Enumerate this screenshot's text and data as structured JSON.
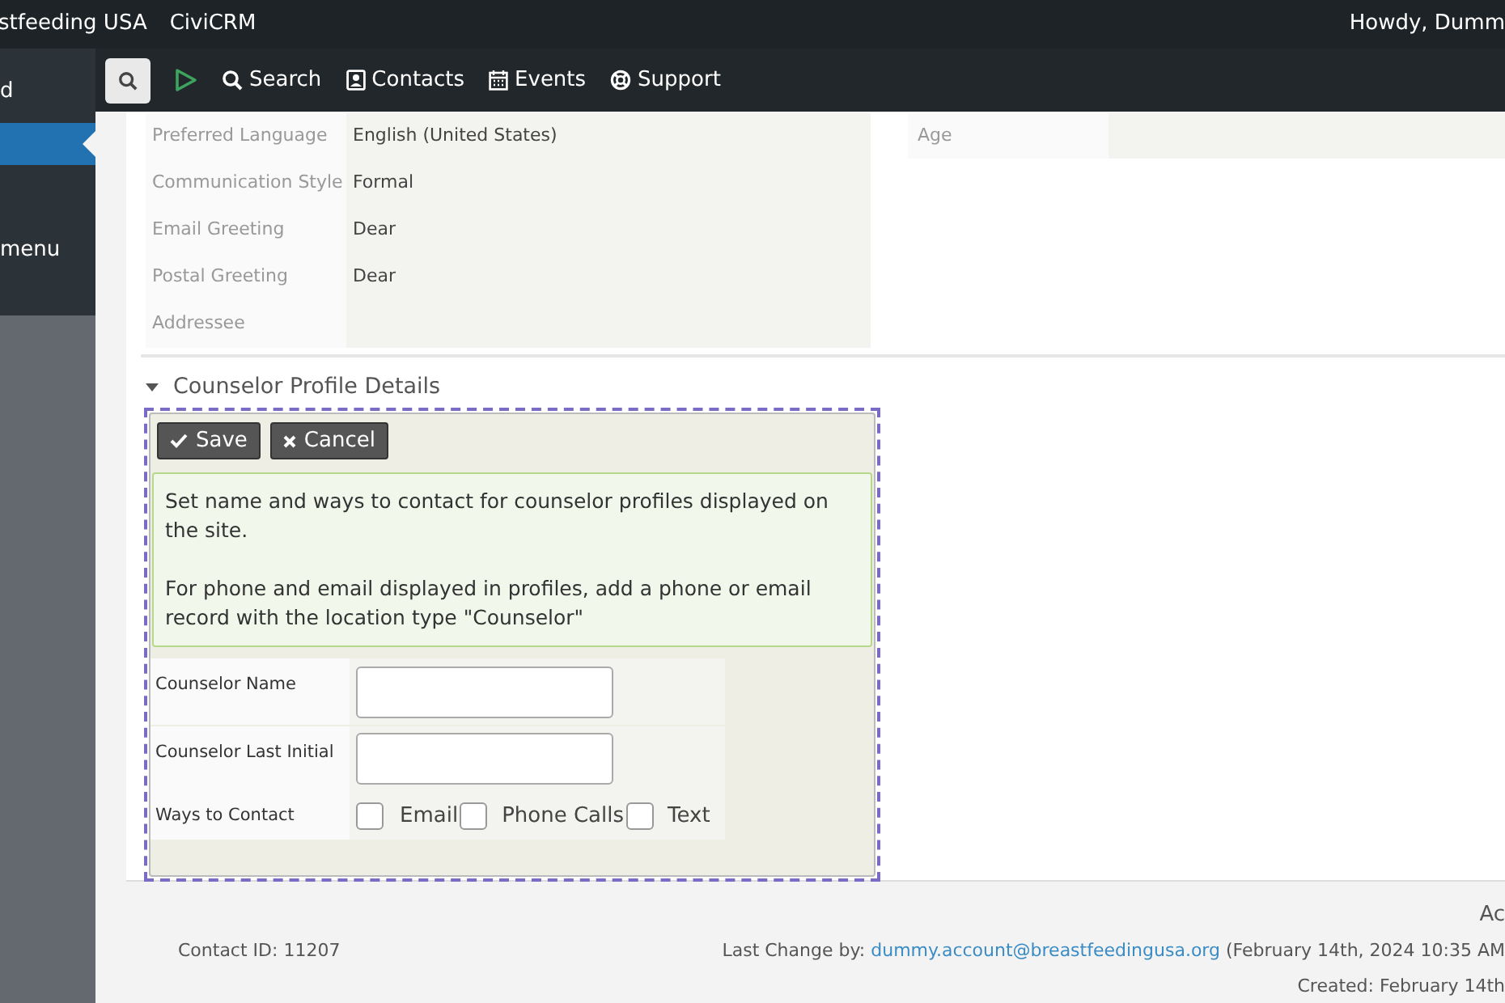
{
  "admin_bar": {
    "site_name": "stfeeding USA",
    "app_name": "CiviCRM",
    "greeting": "Howdy, Dumm"
  },
  "sidebar": {
    "items": [
      {
        "label": "d",
        "selected": false
      },
      {
        "selected": true
      },
      {
        "label": "menu",
        "selected": false
      }
    ]
  },
  "civi_nav": {
    "items": [
      {
        "label": "Search"
      },
      {
        "label": "Contacts"
      },
      {
        "label": "Events"
      },
      {
        "label": "Support"
      }
    ]
  },
  "details": {
    "rows": [
      {
        "label": "Preferred Language",
        "value": "English (United States)"
      },
      {
        "label": "Communication Style",
        "value": "Formal"
      },
      {
        "label": "Email Greeting",
        "value": "Dear"
      },
      {
        "label": "Postal Greeting",
        "value": "Dear"
      },
      {
        "label": "Addressee",
        "value": ""
      }
    ],
    "right_label": "Age"
  },
  "section": {
    "title": "Counselor Profile Details",
    "expanded": true,
    "buttons": [
      {
        "label": "Save"
      },
      {
        "label": "Cancel"
      }
    ],
    "help": [
      "Set name and ways to contact for counselor profiles displayed on the site.",
      "For phone and email displayed in profiles, add a phone or email record with the location type \"Counselor\""
    ],
    "fields": [
      {
        "label": "Counselor Name",
        "kind": "text"
      },
      {
        "label": "Counselor Last Initial",
        "kind": "text"
      },
      {
        "label": "Ways to Contact",
        "kind": "checkboxes",
        "options": [
          {
            "label": "Email",
            "checked": false
          },
          {
            "label": "Phone Calls",
            "checked": false
          },
          {
            "label": "Text",
            "checked": false
          }
        ]
      }
    ]
  },
  "footer": {
    "right_cut": "Ac",
    "contact_id": "Contact ID: 11207",
    "last_change_label": "Last Change by:",
    "last_change_link": "dummy.account@breastfeedingusa.org",
    "last_change_date": "(February 14th, 2024 10:35 AM",
    "created": "Created: February 14th"
  }
}
